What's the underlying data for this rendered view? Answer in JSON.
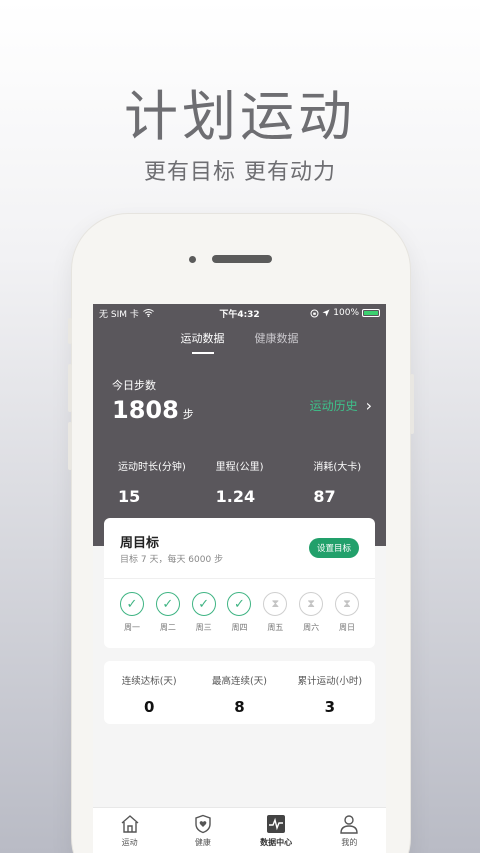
{
  "promo": {
    "title": "计划运动",
    "subtitle": "更有目标 更有动力"
  },
  "status_bar": {
    "carrier": "无 SIM 卡",
    "time": "下午4:32",
    "battery": "100%"
  },
  "tabs": [
    {
      "label": "运动数据",
      "active": true
    },
    {
      "label": "健康数据",
      "active": false
    }
  ],
  "today": {
    "label": "今日步数",
    "steps": "1808",
    "unit": "步",
    "history_link": "运动历史"
  },
  "stats": [
    {
      "label": "运动时长(分钟)",
      "value": "15"
    },
    {
      "label": "里程(公里)",
      "value": "1.24"
    },
    {
      "label": "消耗(大卡)",
      "value": "87"
    }
  ],
  "weekly_goal": {
    "title": "周目标",
    "description": "目标 7 天，每天 6000 步",
    "button": "设置目标",
    "days": [
      {
        "label": "周一",
        "done": true
      },
      {
        "label": "周二",
        "done": true
      },
      {
        "label": "周三",
        "done": true
      },
      {
        "label": "周四",
        "done": true
      },
      {
        "label": "周五",
        "done": false
      },
      {
        "label": "周六",
        "done": false
      },
      {
        "label": "周日",
        "done": false
      }
    ]
  },
  "streaks": [
    {
      "label": "连续达标(天)",
      "value": "0"
    },
    {
      "label": "最高连续(天)",
      "value": "8"
    },
    {
      "label": "累计运动(小时)",
      "value": "3"
    }
  ],
  "bottom_nav": [
    {
      "label": "运动",
      "icon": "home-icon",
      "active": false
    },
    {
      "label": "健康",
      "icon": "shield-heart-icon",
      "active": false
    },
    {
      "label": "数据中心",
      "icon": "pulse-chart-icon",
      "active": true
    },
    {
      "label": "我的",
      "icon": "person-icon",
      "active": false
    }
  ],
  "colors": {
    "accent": "#22a06b",
    "header_bg": "#5a575c",
    "check": "#3fb483"
  }
}
